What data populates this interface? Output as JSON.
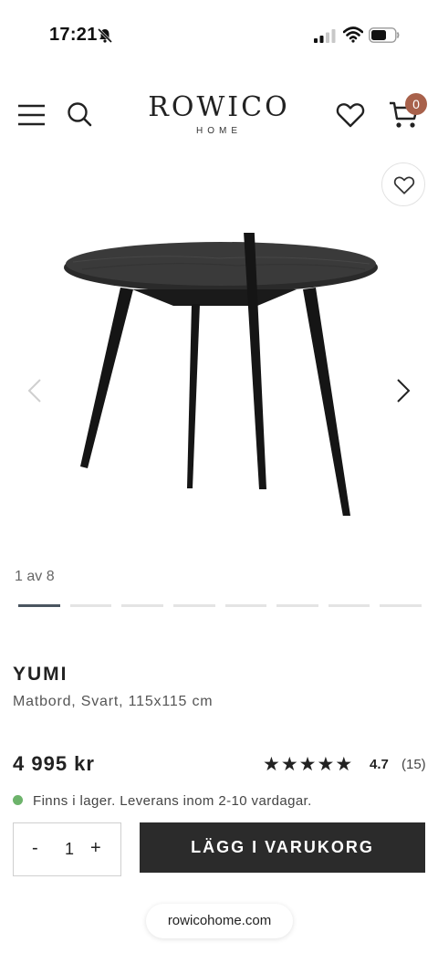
{
  "status_bar": {
    "time": "17:21",
    "icons": [
      "bell-off-icon",
      "signal-icon",
      "wifi-icon",
      "battery-icon"
    ]
  },
  "header": {
    "logo_main": "ROWICO",
    "logo_sub": "HOME",
    "cart_count": "0",
    "icons": [
      "menu-icon",
      "search-icon",
      "heart-icon",
      "cart-icon"
    ]
  },
  "gallery": {
    "counter": "1 av 8",
    "total_images": 8,
    "active_index": 1,
    "product_image": "black-round-dining-table"
  },
  "product": {
    "name": "YUMI",
    "description": "Matbord, Svart, 115x115 cm",
    "price": "4 995 kr",
    "rating": "4.7",
    "review_count": "(15)",
    "stars_filled": 5,
    "stock_text": "Finns i lager. Leverans inom 2-10 vardagar."
  },
  "purchase": {
    "minus_label": "-",
    "quantity": "1",
    "plus_label": "+",
    "add_to_cart_label": "LÄGG I VARUKORG"
  },
  "browser": {
    "url": "rowicohome.com"
  },
  "colors": {
    "accent_badge": "#a8614b",
    "button_dark": "#2b2b2b",
    "stock_green": "#6db36b",
    "active_dot": "#4a5560"
  }
}
